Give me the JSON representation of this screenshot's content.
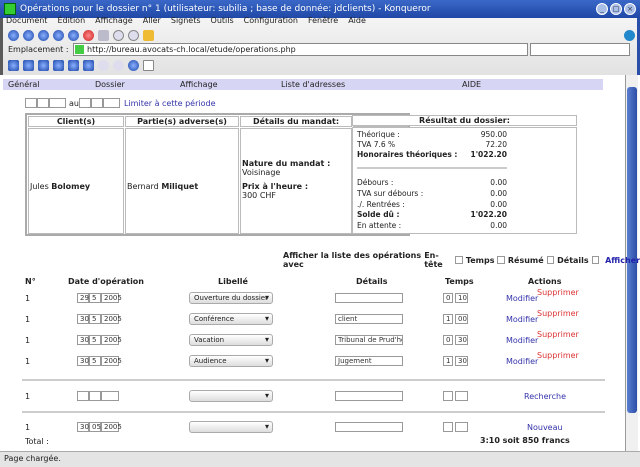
{
  "window": {
    "title": "Opérations pour le dossier n° 1 (utilisateur: subilia ; base de donnée: jdclients) - Konqueror"
  },
  "menu": [
    "Document",
    "Édition",
    "Affichage",
    "Aller",
    "Signets",
    "Outils",
    "Configuration",
    "Fenêtre",
    "Aide"
  ],
  "location": {
    "label": "Emplacement :",
    "url": "http://bureau.avocats-ch.local/etude/operations.php"
  },
  "nav": [
    "Général",
    "Dossier",
    "Affichage",
    "Liste d'adresses",
    "AIDE"
  ],
  "period": {
    "au": "au",
    "link": "Limiter à cette période"
  },
  "fiche": {
    "headers": [
      "Client(s)",
      "Partie(s) adverse(s)",
      "Détails du mandat:",
      "Résultat du dossier:"
    ],
    "client_first": "Jules",
    "client_last": "Bolomey",
    "adverse_first": "Bernard",
    "adverse_last": "Miliquet",
    "nature_label": "Nature du mandat :",
    "nature": "Voisinage",
    "prix_label": "Prix à l'heure :",
    "prix": "300 CHF",
    "results": [
      {
        "label": "Théorique :",
        "value": "950.00",
        "bold": false
      },
      {
        "label": "TVA 7.6 %",
        "value": "72.20",
        "bold": false
      },
      {
        "label": "Honoraires théoriques :",
        "value": "1'022.20",
        "bold": true
      },
      {
        "label": "Débours :",
        "value": "0.00",
        "bold": false
      },
      {
        "label": "TVA sur débours :",
        "value": "0.00",
        "bold": false
      },
      {
        "label": "./. Rentrées :",
        "value": "0.00",
        "bold": false
      },
      {
        "label": "Solde dû :",
        "value": "1'022.20",
        "bold": true
      },
      {
        "label": "En attente :",
        "value": "0.00",
        "bold": false
      }
    ]
  },
  "show": {
    "label": "Afficher la liste des opérations avec",
    "options": [
      "En-tête",
      "Temps",
      "Résumé",
      "Détails"
    ],
    "button": "Afficher"
  },
  "columns": [
    "N°",
    "Date d'opération",
    "Libellé",
    "Détails",
    "Temps",
    "Actions"
  ],
  "operations": [
    {
      "n": "1",
      "day": "29",
      "month": "5",
      "year": "2005",
      "libelle": "Ouverture du dossier",
      "details": "",
      "h": "0",
      "m": "10"
    },
    {
      "n": "1",
      "day": "30",
      "month": "5",
      "year": "2005",
      "libelle": "Conférence",
      "details": "client",
      "h": "1",
      "m": "00"
    },
    {
      "n": "1",
      "day": "30",
      "month": "5",
      "year": "2005",
      "libelle": "Vacation",
      "details": "Tribunal de Prud'homm",
      "h": "0",
      "m": "30"
    },
    {
      "n": "1",
      "day": "30",
      "month": "5",
      "year": "2005",
      "libelle": "Audience",
      "details": "Jugement",
      "h": "1",
      "m": "30"
    }
  ],
  "actions": {
    "modify": "Modifier",
    "delete": "Supprimer",
    "search": "Recherche",
    "new": "Nouveau"
  },
  "search_row": {
    "n": "1"
  },
  "new_row": {
    "n": "1",
    "day": "30",
    "month": "05",
    "year": "2005"
  },
  "total": {
    "label": "Total :",
    "value": "3:10 soit 850 francs"
  },
  "status": "Page chargée."
}
